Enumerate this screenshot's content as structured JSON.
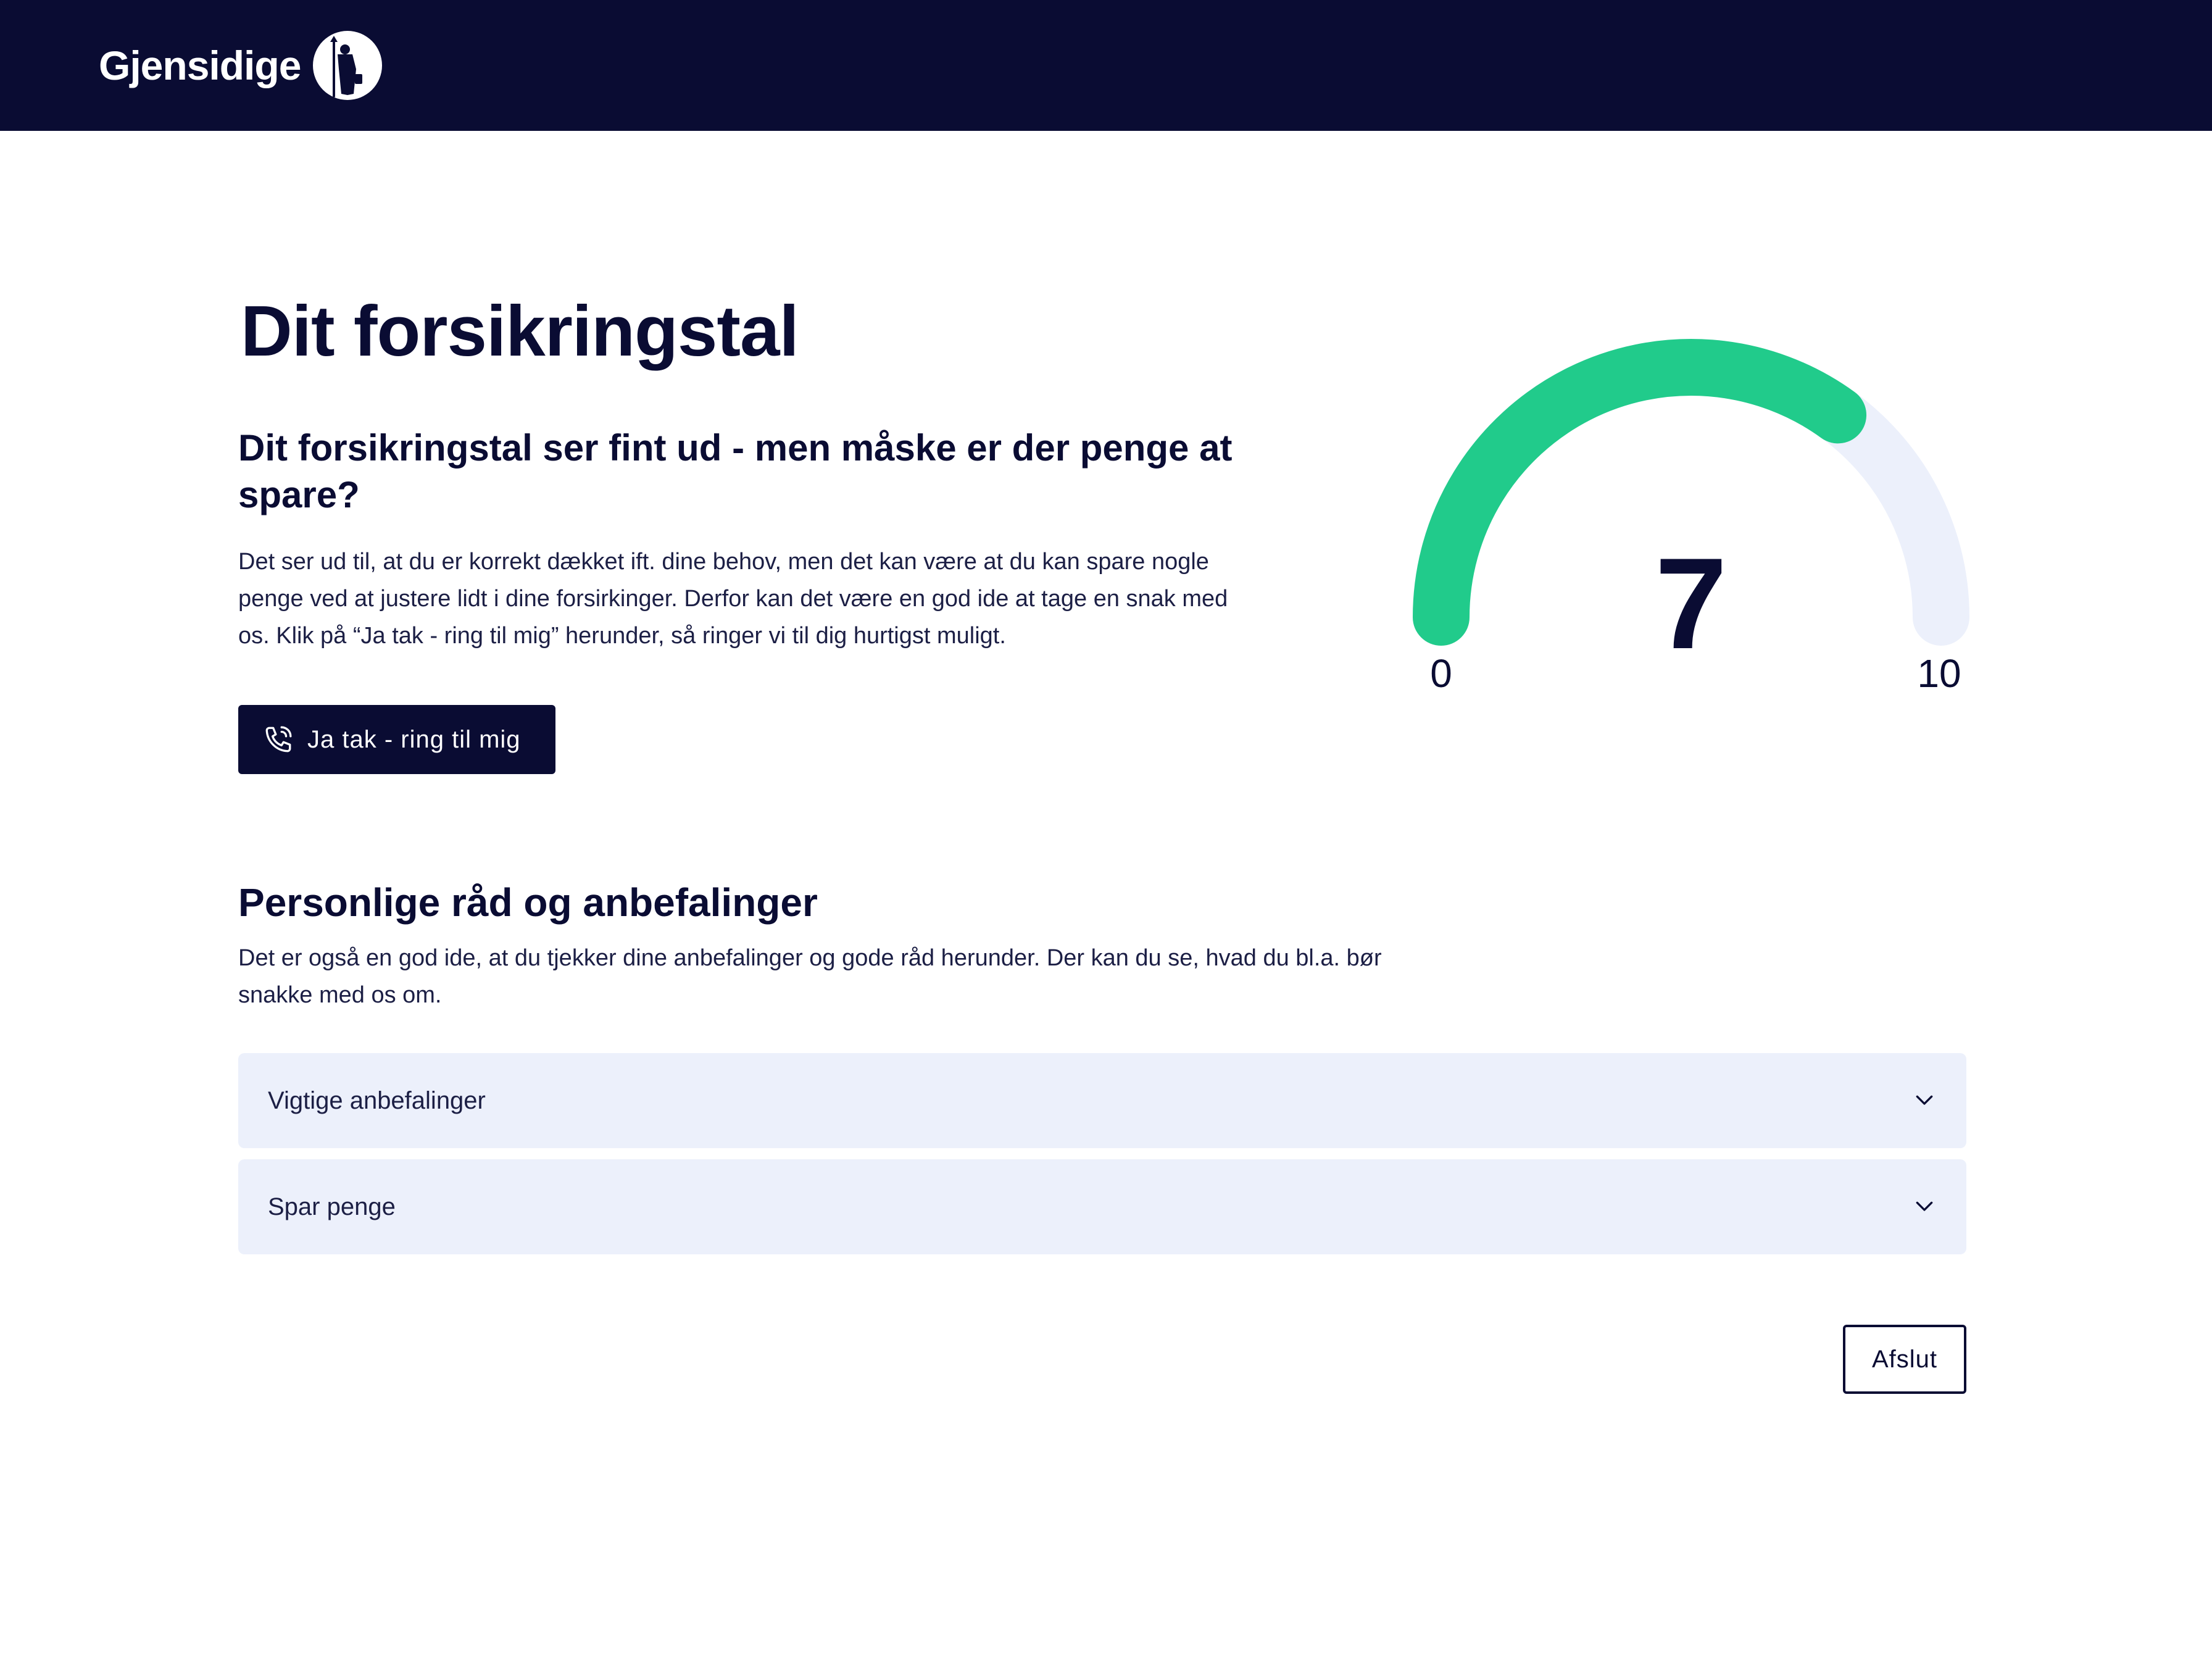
{
  "header": {
    "brand_name": "Gjensidige",
    "logo_icon": "night-watchman-logo-icon",
    "background_color": "#0a0c33"
  },
  "main": {
    "title": "Dit forsikringstal",
    "subheading": "Dit forsikringstal ser fint ud - men måske er der penge at spare?",
    "body": "Det ser ud til, at du er korrekt dækket ift. dine behov, men det kan være at du kan spare nogle penge ved at justere lidt i dine forsirkinger. Derfor kan det være en god ide at tage en snak med os. Klik på “Ja tak - ring til mig” herunder, så ringer vi til dig hurtigst muligt.",
    "call_button": {
      "label": "Ja tak - ring til mig",
      "icon": "phone-icon"
    }
  },
  "gauge": {
    "value": 7,
    "value_label": "7",
    "min": 0,
    "max": 10,
    "min_label": "0",
    "max_label": "10",
    "fill_color": "#21cb8b",
    "track_color": "#ecf0fb"
  },
  "advice": {
    "title": "Personlige råd og anbefalinger",
    "text": "Det er også en god ide, at du tjekker dine anbefalinger og gode råd herunder. Der kan du se, hvad du bl.a. bør snakke med os om.",
    "accordions": [
      {
        "label": "Vigtige anbefalinger",
        "icon": "chevron-down-icon"
      },
      {
        "label": "Spar penge",
        "icon": "chevron-down-icon"
      }
    ]
  },
  "footer": {
    "exit_label": "Afslut"
  },
  "colors": {
    "navy": "#0a0c33",
    "accordion_bg": "#ecf0fb",
    "accent_green": "#21cb8b"
  }
}
